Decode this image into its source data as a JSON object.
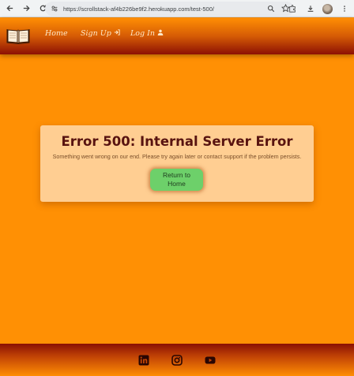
{
  "browser": {
    "url": "https://scrollstack-af4b226be9f2.herokuapp.com/test-500/",
    "icons": [
      "back-arrow-icon",
      "forward-arrow-icon",
      "reload-icon",
      "site-info-icon",
      "zoom-icon",
      "bookmark-star-icon",
      "extensions-icon",
      "download-icon",
      "profile-avatar",
      "menu-kebab-icon"
    ]
  },
  "header": {
    "logo_icon": "open-book-icon",
    "nav": {
      "home": "Home",
      "signup": "Sign Up",
      "login": "Log In"
    },
    "colors": {
      "top": "#ff8e04",
      "bottom": "#8c1004",
      "link": "#ffe8c8"
    }
  },
  "error": {
    "title": "Error 500: Internal Server Error",
    "message": "Something went wrong on our end. Please try again later or contact support if the problem persists.",
    "button_label": "Return to Home"
  },
  "footer": {
    "social_icons": [
      "linkedin-icon",
      "instagram-icon",
      "youtube-icon"
    ]
  },
  "colors": {
    "page_background": "#ff9004",
    "card_background": "#ffce92",
    "title": "#581310",
    "button": "#6dd06a"
  }
}
